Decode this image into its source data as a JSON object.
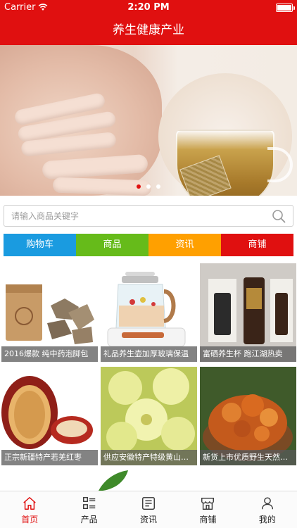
{
  "status": {
    "carrier": "Carrier",
    "time": "2:20 PM"
  },
  "navbar": {
    "title": "养生健康产业"
  },
  "carousel": {
    "page_count": 3,
    "active_page": 1
  },
  "search": {
    "placeholder": "请输入商品关键字"
  },
  "categories": [
    {
      "label": "购物车",
      "color": "#1a9be0"
    },
    {
      "label": "商品",
      "color": "#66bb1a"
    },
    {
      "label": "资讯",
      "color": "#ffa000"
    },
    {
      "label": "商铺",
      "color": "#e01010"
    }
  ],
  "products": [
    {
      "title": "2016爆款 纯中药泡脚包"
    },
    {
      "title": "礼品养生壶加厚玻璃保温"
    },
    {
      "title": "富硒养生杯 跑江湖热卖"
    },
    {
      "title": "正宗新疆特产若羌红枣"
    },
    {
      "title": "供应安徽特产特级黄山贡菊"
    },
    {
      "title": "新货上市优质野生天然桃胶"
    }
  ],
  "tabs": [
    {
      "label": "首页",
      "icon": "home-icon",
      "active": true
    },
    {
      "label": "产品",
      "icon": "list-icon"
    },
    {
      "label": "资讯",
      "icon": "news-icon"
    },
    {
      "label": "商铺",
      "icon": "shop-icon"
    },
    {
      "label": "我的",
      "icon": "user-icon"
    }
  ],
  "colors": {
    "brand_red": "#e01010",
    "caption_bg": "#5a5a5a"
  }
}
